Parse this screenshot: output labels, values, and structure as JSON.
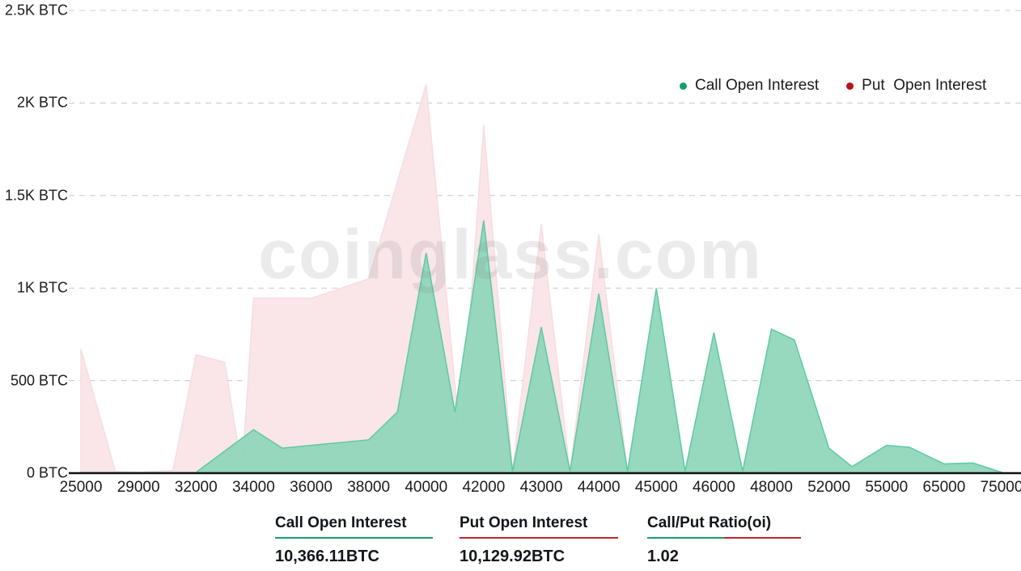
{
  "watermark": "coinglass.com",
  "legend": [
    {
      "label": "Call Open Interest",
      "color": "#159f68",
      "series": "call"
    },
    {
      "label": "Put  Open Interest",
      "color": "#b3161a",
      "series": "put"
    }
  ],
  "colors": {
    "call_line": "#5fc9a4",
    "call_fill": "#8ed6b9",
    "put_line": "#f7dde1",
    "put_fill": "#fae5e9",
    "axis": "#111111",
    "grid": "#c8c8c8",
    "text": "#1b1b1b",
    "call_accent": "#159f68",
    "put_accent": "#c0272d"
  },
  "stats": [
    {
      "id": "call",
      "title": "Call Open Interest",
      "value": "10,366.11BTC",
      "rule": [
        "#159f68"
      ]
    },
    {
      "id": "put",
      "title": "Put Open Interest",
      "value": "10,129.92BTC",
      "rule": [
        "#c0272d"
      ]
    },
    {
      "id": "ratio",
      "title": "Call/Put Ratio(oi)",
      "value": "1.02",
      "rule": [
        "#159f68",
        "#c0272d"
      ]
    }
  ],
  "chart_data": {
    "type": "area",
    "title": "",
    "xlabel": "",
    "ylabel": "",
    "grid": true,
    "legend_position": "top-right",
    "xlim": [
      0,
      16
    ],
    "ylim": [
      0,
      2500
    ],
    "ytick_values": [
      0,
      500,
      1000,
      1500,
      2000,
      2500
    ],
    "ytick_labels": [
      "0 BTC",
      "500 BTC",
      "1K BTC",
      "1.5K BTC",
      "2K BTC",
      "2.5K BTC"
    ],
    "categories": [
      "25000",
      "29000",
      "32000",
      "34000",
      "36000",
      "38000",
      "40000",
      "42000",
      "43000",
      "44000",
      "45000",
      "46000",
      "48000",
      "52000",
      "55000",
      "65000",
      "75000"
    ],
    "series": [
      {
        "name": "Call Open Interest",
        "values": [
          3,
          3,
          4,
          235,
          135,
          175,
          1190,
          1365,
          790,
          970,
          1000,
          760,
          778,
          135,
          150,
          50,
          5
        ]
      },
      {
        "name": "Put Open Interest",
        "values": [
          670,
          5,
          640,
          945,
          945,
          1050,
          2100,
          1880,
          1345,
          1290,
          8,
          6,
          5,
          4,
          3,
          2,
          0
        ]
      }
    ],
    "series_detail": {
      "call_points": [
        {
          "x": 0,
          "y": 3
        },
        {
          "x": 1,
          "y": 3
        },
        {
          "x": 2,
          "y": 4
        },
        {
          "x": 3,
          "y": 235
        },
        {
          "x": 3.5,
          "y": 135
        },
        {
          "x": 4,
          "y": 150
        },
        {
          "x": 5,
          "y": 180
        },
        {
          "x": 5.5,
          "y": 330
        },
        {
          "x": 6,
          "y": 1190
        },
        {
          "x": 6.5,
          "y": 330
        },
        {
          "x": 7,
          "y": 1365
        },
        {
          "x": 7.5,
          "y": 10
        },
        {
          "x": 8,
          "y": 790
        },
        {
          "x": 8.5,
          "y": 10
        },
        {
          "x": 9,
          "y": 970
        },
        {
          "x": 9.5,
          "y": 10
        },
        {
          "x": 10,
          "y": 1000
        },
        {
          "x": 10.5,
          "y": 10
        },
        {
          "x": 11,
          "y": 760
        },
        {
          "x": 11.5,
          "y": 10
        },
        {
          "x": 12,
          "y": 778
        },
        {
          "x": 12.4,
          "y": 720
        },
        {
          "x": 13,
          "y": 135
        },
        {
          "x": 13.4,
          "y": 35
        },
        {
          "x": 14,
          "y": 150
        },
        {
          "x": 14.4,
          "y": 140
        },
        {
          "x": 15,
          "y": 50
        },
        {
          "x": 15.5,
          "y": 55
        },
        {
          "x": 16,
          "y": 5
        }
      ],
      "put_points": [
        {
          "x": 0,
          "y": 670
        },
        {
          "x": 0.6,
          "y": 10
        },
        {
          "x": 1,
          "y": 5
        },
        {
          "x": 1.6,
          "y": 15
        },
        {
          "x": 2,
          "y": 640
        },
        {
          "x": 2.5,
          "y": 600
        },
        {
          "x": 2.8,
          "y": 10
        },
        {
          "x": 3,
          "y": 945
        },
        {
          "x": 4,
          "y": 945
        },
        {
          "x": 5,
          "y": 1050
        },
        {
          "x": 6,
          "y": 2100
        },
        {
          "x": 6.6,
          "y": 160
        },
        {
          "x": 7,
          "y": 1880
        },
        {
          "x": 7.5,
          "y": 8
        },
        {
          "x": 8,
          "y": 1345
        },
        {
          "x": 8.5,
          "y": 8
        },
        {
          "x": 9,
          "y": 1290
        },
        {
          "x": 9.5,
          "y": 6
        },
        {
          "x": 10,
          "y": 8
        },
        {
          "x": 11,
          "y": 6
        },
        {
          "x": 12,
          "y": 5
        },
        {
          "x": 13,
          "y": 4
        },
        {
          "x": 14,
          "y": 3
        },
        {
          "x": 15,
          "y": 2
        },
        {
          "x": 16,
          "y": 0
        }
      ]
    }
  }
}
